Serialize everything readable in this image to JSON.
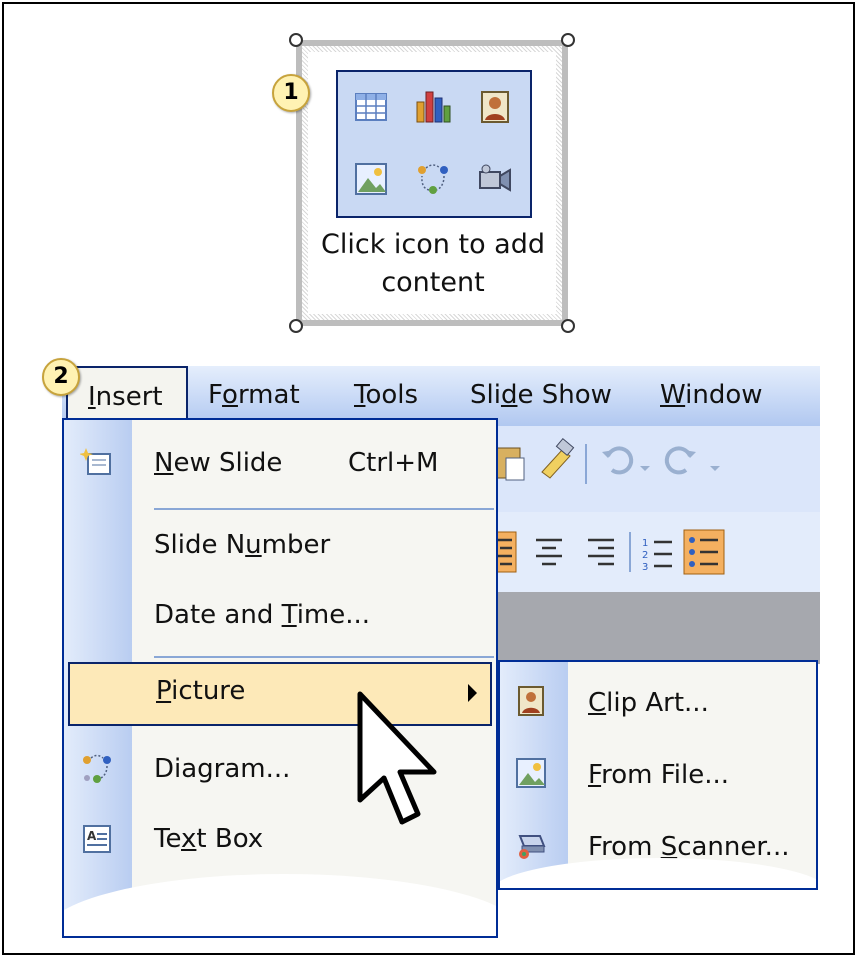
{
  "step1": {
    "badge": "1",
    "placeholder_text_line1": "Click icon to add",
    "placeholder_text_line2": "content",
    "icons": [
      "table-icon",
      "chart-icon",
      "clipart-icon",
      "picture-icon",
      "diagram-icon",
      "media-clip-icon"
    ]
  },
  "step2": {
    "badge": "2",
    "menubar": {
      "items": [
        {
          "pre": "",
          "u": "I",
          "post": "nsert"
        },
        {
          "pre": "F",
          "u": "o",
          "post": "rmat"
        },
        {
          "pre": "",
          "u": "T",
          "post": "ools"
        },
        {
          "pre": "Sli",
          "u": "d",
          "post": "e Show"
        },
        {
          "pre": "",
          "u": "W",
          "post": "indow"
        }
      ]
    },
    "insert_menu": {
      "new_slide": {
        "pre": "",
        "u": "N",
        "post": "ew Slide"
      },
      "new_slide_shortcut": "Ctrl+M",
      "slide_number": {
        "pre": "Slide N",
        "u": "u",
        "post": "mber"
      },
      "date_time": {
        "pre": "Date and ",
        "u": "T",
        "post": "ime..."
      },
      "picture": {
        "pre": "",
        "u": "P",
        "post": "icture"
      },
      "diagram": "Diagram...",
      "text_box": {
        "pre": "Te",
        "u": "x",
        "post": "t Box"
      }
    },
    "picture_submenu": {
      "clip_art": {
        "pre": "",
        "u": "C",
        "post": "lip Art..."
      },
      "from_file": {
        "pre": "",
        "u": "F",
        "post": "rom File..."
      },
      "from_scanner": {
        "pre": "From ",
        "u": "S",
        "post": "canner..."
      }
    }
  },
  "colors": {
    "accent_border": "#0a246a",
    "highlight": "#fde9b8",
    "menubar": "#c8d9f6"
  }
}
